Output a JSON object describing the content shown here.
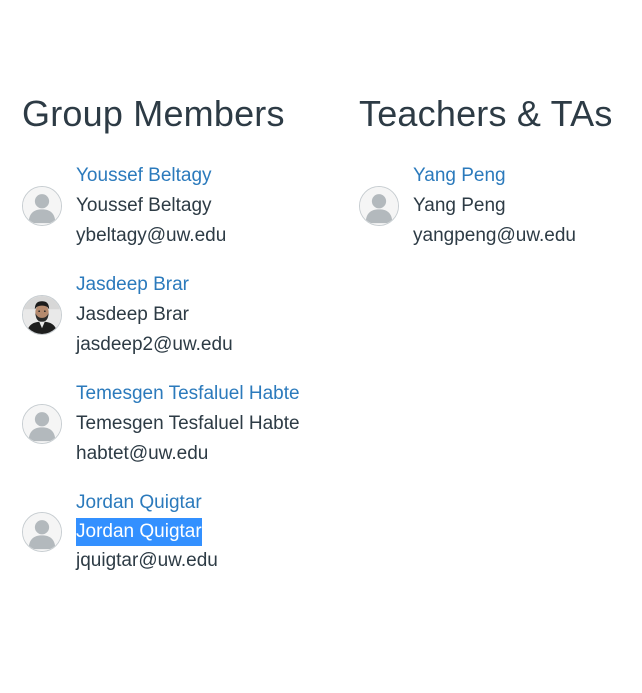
{
  "group_members": {
    "title": "Group Members",
    "people": [
      {
        "link": "Youssef Beltagy",
        "name": "Youssef Beltagy",
        "email": "ybeltagy@uw.edu",
        "avatar": "default-avatar-icon"
      },
      {
        "link": "Jasdeep Brar",
        "name": "Jasdeep Brar",
        "email": "jasdeep2@uw.edu",
        "avatar": "profile-photo"
      },
      {
        "link": "Temesgen Tesfaluel Habte",
        "name": "Temesgen Tesfaluel Habte",
        "email": "habtet@uw.edu",
        "avatar": "default-avatar-icon"
      },
      {
        "link": "Jordan Quigtar",
        "name": "Jordan Quigtar",
        "email": "jquigtar@uw.edu",
        "avatar": "default-avatar-icon",
        "name_selected": true
      }
    ]
  },
  "teachers": {
    "title": "Teachers & TAs",
    "people": [
      {
        "link": "Yang Peng",
        "name": "Yang Peng",
        "email": "yangpeng@uw.edu",
        "avatar": "default-avatar-icon"
      }
    ]
  },
  "colors": {
    "link": "#2b7abc",
    "text": "#2d3b45",
    "selection": "#3390ff"
  }
}
